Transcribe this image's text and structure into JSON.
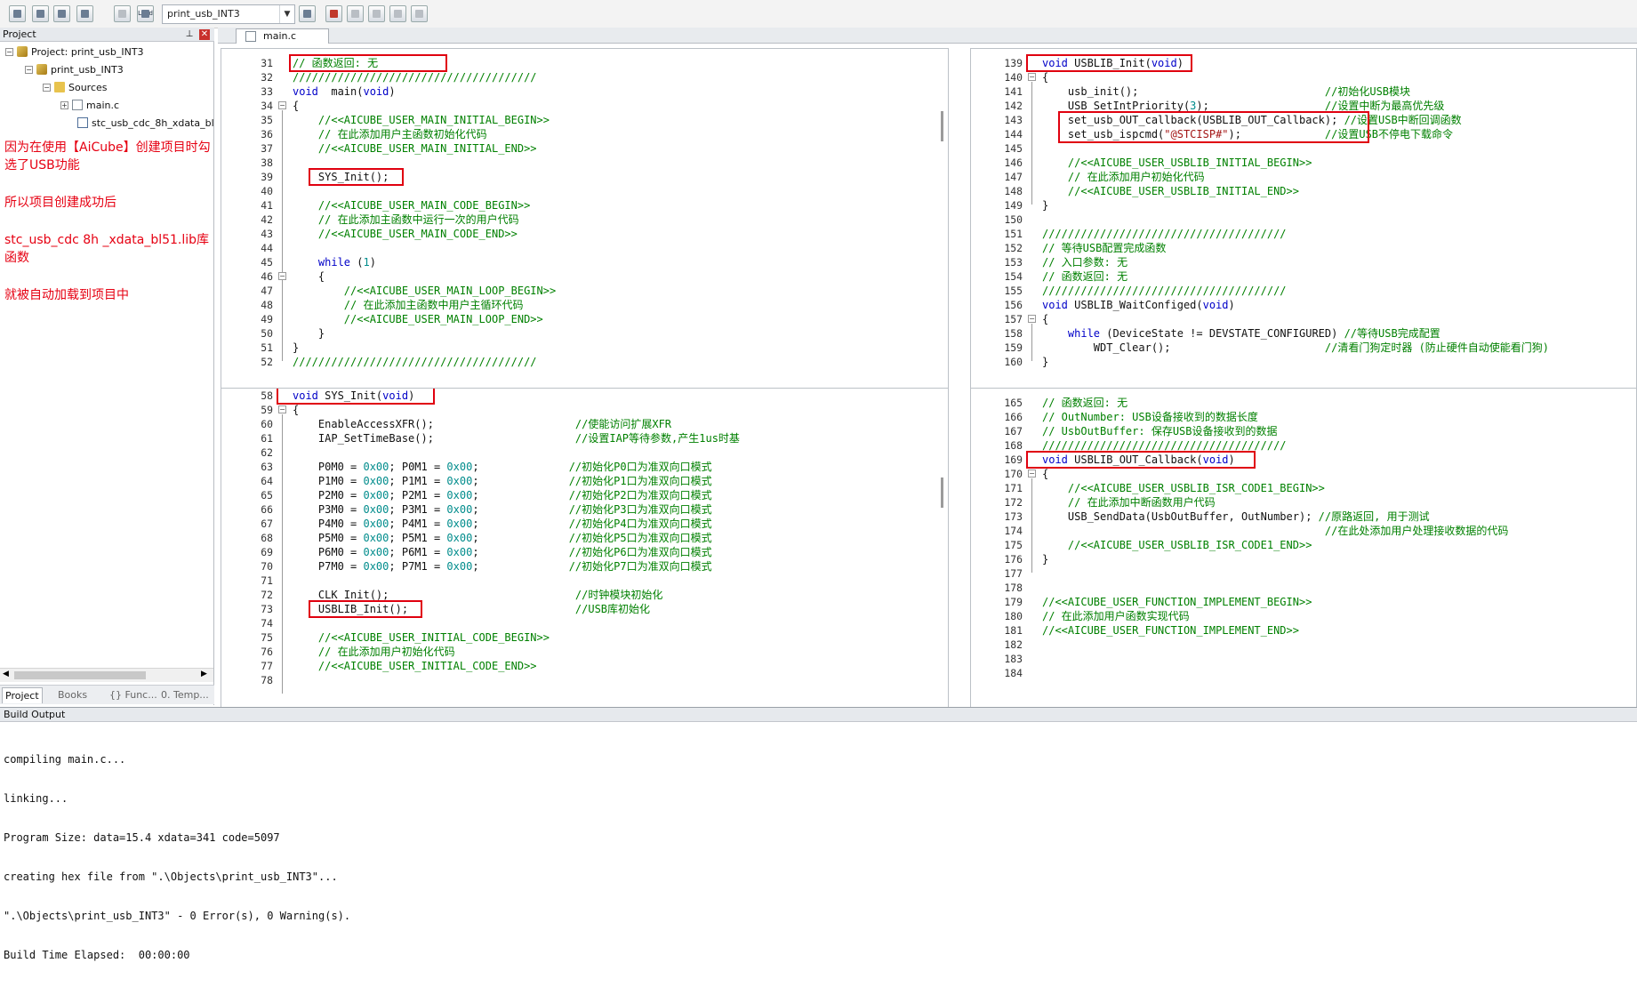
{
  "toolbar": {
    "target": "print_usb_INT3",
    "load_label": "Load"
  },
  "project": {
    "header": "Project",
    "tree": {
      "root": "Project: print_usb_INT3",
      "target": "print_usb_INT3",
      "group": "Sources",
      "files": [
        "main.c",
        "stc_usb_cdc_8h_xdata_bl"
      ]
    },
    "note": [
      "因为在使用【AiCube】创建项目时勾选了USB功能",
      "所以项目创建成功后",
      "stc_usb_cdc 8h _xdata_bl51.lib库函数",
      "就被自动加载到项目中"
    ],
    "tabs": [
      "Project",
      "Books",
      "{} Func...",
      "0. Temp..."
    ]
  },
  "editor": {
    "tab": "main.c",
    "panes": [
      {
        "id": "tl",
        "start": 31,
        "lines": [
          [
            [
              "cm",
              "// 函数返回: 无"
            ]
          ],
          [
            [
              "cm",
              "//////////////////////////////////////"
            ]
          ],
          [
            [
              "kw",
              "void"
            ],
            [
              "",
              "  main("
            ],
            [
              "kw",
              "void"
            ],
            [
              "",
              ")"
            ]
          ],
          [
            [
              "",
              "{"
            ]
          ],
          [
            [
              "cm",
              "    //<<AICUBE_USER_MAIN_INITIAL_BEGIN>>"
            ]
          ],
          [
            [
              "cm",
              "    // 在此添加用户主函数初始化代码"
            ]
          ],
          [
            [
              "cm",
              "    //<<AICUBE_USER_MAIN_INITIAL_END>>"
            ]
          ],
          [
            [
              "",
              ""
            ]
          ],
          [
            [
              "",
              "    SYS_Init();"
            ]
          ],
          [
            [
              "",
              ""
            ]
          ],
          [
            [
              "cm",
              "    //<<AICUBE_USER_MAIN_CODE_BEGIN>>"
            ]
          ],
          [
            [
              "cm",
              "    // 在此添加主函数中运行一次的用户代码"
            ]
          ],
          [
            [
              "cm",
              "    //<<AICUBE_USER_MAIN_CODE_END>>"
            ]
          ],
          [
            [
              "",
              ""
            ]
          ],
          [
            [
              "",
              "    "
            ],
            [
              "kw",
              "while"
            ],
            [
              "",
              " ("
            ],
            [
              "num",
              "1"
            ],
            [
              "",
              ")"
            ]
          ],
          [
            [
              "",
              "    {"
            ]
          ],
          [
            [
              "cm",
              "        //<<AICUBE_USER_MAIN_LOOP_BEGIN>>"
            ]
          ],
          [
            [
              "cm",
              "        // 在此添加主函数中用户主循环代码"
            ]
          ],
          [
            [
              "cm",
              "        //<<AICUBE_USER_MAIN_LOOP_END>>"
            ]
          ],
          [
            [
              "",
              "    }"
            ]
          ],
          [
            [
              "",
              "}"
            ]
          ],
          [
            [
              "cm",
              "//////////////////////////////////////"
            ]
          ]
        ]
      },
      {
        "id": "tr",
        "start": 139,
        "lines": [
          [
            [
              "kw",
              "void"
            ],
            [
              "",
              " USBLIB_Init("
            ],
            [
              "kw",
              "void"
            ],
            [
              "",
              ")"
            ]
          ],
          [
            [
              "",
              "{"
            ]
          ],
          [
            [
              "",
              "    usb_init();                             "
            ],
            [
              "cm",
              "//初始化USB模块"
            ]
          ],
          [
            [
              "",
              "    USB_SetIntPriority("
            ],
            [
              "num",
              "3"
            ],
            [
              "",
              ");                  "
            ],
            [
              "cm",
              "//设置中断为最高优先级"
            ]
          ],
          [
            [
              "",
              "    set_usb_OUT_callback(USBLIB_OUT_Callback); "
            ],
            [
              "cm",
              "//设置USB中断回调函数"
            ]
          ],
          [
            [
              "",
              "    set_usb_ispcmd("
            ],
            [
              "str",
              "\"@STCISP#\""
            ],
            [
              "",
              ");             "
            ],
            [
              "cm",
              "//设置USB不停电下载命令"
            ]
          ],
          [
            [
              "",
              ""
            ]
          ],
          [
            [
              "cm",
              "    //<<AICUBE_USER_USBLIB_INITIAL_BEGIN>>"
            ]
          ],
          [
            [
              "cm",
              "    // 在此添加用户初始化代码"
            ]
          ],
          [
            [
              "cm",
              "    //<<AICUBE_USER_USBLIB_INITIAL_END>>"
            ]
          ],
          [
            [
              "",
              "}"
            ]
          ],
          [
            [
              "",
              ""
            ]
          ],
          [
            [
              "cm",
              "//////////////////////////////////////"
            ]
          ],
          [
            [
              "cm",
              "// 等待USB配置完成函数"
            ]
          ],
          [
            [
              "cm",
              "// 入口参数: 无"
            ]
          ],
          [
            [
              "cm",
              "// 函数返回: 无"
            ]
          ],
          [
            [
              "cm",
              "//////////////////////////////////////"
            ]
          ],
          [
            [
              "kw",
              "void"
            ],
            [
              "",
              " USBLIB_WaitConfiged("
            ],
            [
              "kw",
              "void"
            ],
            [
              "",
              ")"
            ]
          ],
          [
            [
              "",
              "{"
            ]
          ],
          [
            [
              "",
              "    "
            ],
            [
              "kw",
              "while"
            ],
            [
              "",
              " (DeviceState != DEVSTATE_CONFIGURED) "
            ],
            [
              "cm",
              "//等待USB完成配置"
            ]
          ],
          [
            [
              "",
              "        WDT_Clear();                        "
            ],
            [
              "cm",
              "//清看门狗定时器 (防止硬件自动使能看门狗)"
            ]
          ],
          [
            [
              "",
              "}"
            ]
          ]
        ]
      },
      {
        "id": "bl",
        "start": 58,
        "lines": [
          [
            [
              "kw",
              "void"
            ],
            [
              "",
              " SYS_Init("
            ],
            [
              "kw",
              "void"
            ],
            [
              "",
              ")"
            ]
          ],
          [
            [
              "",
              "{"
            ]
          ],
          [
            [
              "",
              "    EnableAccessXFR();                      "
            ],
            [
              "cm",
              "//使能访问扩展XFR"
            ]
          ],
          [
            [
              "",
              "    IAP_SetTimeBase();                      "
            ],
            [
              "cm",
              "//设置IAP等待参数,产生1us时基"
            ]
          ],
          [
            [
              "",
              ""
            ]
          ],
          [
            [
              "",
              "    P0M0 = "
            ],
            [
              "num",
              "0x00"
            ],
            [
              "",
              "; P0M1 = "
            ],
            [
              "num",
              "0x00"
            ],
            [
              "",
              ";              "
            ],
            [
              "cm",
              "//初始化P0口为准双向口模式"
            ]
          ],
          [
            [
              "",
              "    P1M0 = "
            ],
            [
              "num",
              "0x00"
            ],
            [
              "",
              "; P1M1 = "
            ],
            [
              "num",
              "0x00"
            ],
            [
              "",
              ";              "
            ],
            [
              "cm",
              "//初始化P1口为准双向口模式"
            ]
          ],
          [
            [
              "",
              "    P2M0 = "
            ],
            [
              "num",
              "0x00"
            ],
            [
              "",
              "; P2M1 = "
            ],
            [
              "num",
              "0x00"
            ],
            [
              "",
              ";              "
            ],
            [
              "cm",
              "//初始化P2口为准双向口模式"
            ]
          ],
          [
            [
              "",
              "    P3M0 = "
            ],
            [
              "num",
              "0x00"
            ],
            [
              "",
              "; P3M1 = "
            ],
            [
              "num",
              "0x00"
            ],
            [
              "",
              ";              "
            ],
            [
              "cm",
              "//初始化P3口为准双向口模式"
            ]
          ],
          [
            [
              "",
              "    P4M0 = "
            ],
            [
              "num",
              "0x00"
            ],
            [
              "",
              "; P4M1 = "
            ],
            [
              "num",
              "0x00"
            ],
            [
              "",
              ";              "
            ],
            [
              "cm",
              "//初始化P4口为准双向口模式"
            ]
          ],
          [
            [
              "",
              "    P5M0 = "
            ],
            [
              "num",
              "0x00"
            ],
            [
              "",
              "; P5M1 = "
            ],
            [
              "num",
              "0x00"
            ],
            [
              "",
              ";              "
            ],
            [
              "cm",
              "//初始化P5口为准双向口模式"
            ]
          ],
          [
            [
              "",
              "    P6M0 = "
            ],
            [
              "num",
              "0x00"
            ],
            [
              "",
              "; P6M1 = "
            ],
            [
              "num",
              "0x00"
            ],
            [
              "",
              ";              "
            ],
            [
              "cm",
              "//初始化P6口为准双向口模式"
            ]
          ],
          [
            [
              "",
              "    P7M0 = "
            ],
            [
              "num",
              "0x00"
            ],
            [
              "",
              "; P7M1 = "
            ],
            [
              "num",
              "0x00"
            ],
            [
              "",
              ";              "
            ],
            [
              "cm",
              "//初始化P7口为准双向口模式"
            ]
          ],
          [
            [
              "",
              ""
            ]
          ],
          [
            [
              "",
              "    CLK_Init();                             "
            ],
            [
              "cm",
              "//时钟模块初始化"
            ]
          ],
          [
            [
              "",
              "    USBLIB_Init();                          "
            ],
            [
              "cm",
              "//USB库初始化"
            ]
          ],
          [
            [
              "",
              ""
            ]
          ],
          [
            [
              "cm",
              "    //<<AICUBE_USER_INITIAL_CODE_BEGIN>>"
            ]
          ],
          [
            [
              "cm",
              "    // 在此添加用户初始化代码"
            ]
          ],
          [
            [
              "cm",
              "    //<<AICUBE_USER_INITIAL_CODE_END>>"
            ]
          ],
          [
            [
              "",
              ""
            ]
          ]
        ]
      },
      {
        "id": "br",
        "start": 165,
        "lines": [
          [
            [
              "cm",
              "// 函数返回: 无"
            ]
          ],
          [
            [
              "cm",
              "// OutNumber: USB设备接收到的数据长度"
            ]
          ],
          [
            [
              "cm",
              "// UsbOutBuffer: 保存USB设备接收到的数据"
            ]
          ],
          [
            [
              "cm",
              "//////////////////////////////////////"
            ]
          ],
          [
            [
              "kw",
              "void"
            ],
            [
              "",
              " USBLIB_OUT_Callback("
            ],
            [
              "kw",
              "void"
            ],
            [
              "",
              ")"
            ]
          ],
          [
            [
              "",
              "{"
            ]
          ],
          [
            [
              "cm",
              "    //<<AICUBE_USER_USBLIB_ISR_CODE1_BEGIN>>"
            ]
          ],
          [
            [
              "cm",
              "    // 在此添加中断函数用户代码"
            ]
          ],
          [
            [
              "",
              "    USB_SendData(UsbOutBuffer, OutNumber); "
            ],
            [
              "cm",
              "//原路返回, 用于测试"
            ]
          ],
          [
            [
              "",
              "                                            "
            ],
            [
              "cm",
              "//在此处添加用户处理接收数据的代码"
            ]
          ],
          [
            [
              "cm",
              "    //<<AICUBE_USER_USBLIB_ISR_CODE1_END>>"
            ]
          ],
          [
            [
              "",
              "}"
            ]
          ],
          [
            [
              "",
              ""
            ]
          ],
          [
            [
              "",
              ""
            ]
          ],
          [
            [
              "cm",
              "//<<AICUBE_USER_FUNCTION_IMPLEMENT_BEGIN>>"
            ]
          ],
          [
            [
              "cm",
              "// 在此添加用户函数实现代码"
            ]
          ],
          [
            [
              "cm",
              "//<<AICUBE_USER_FUNCTION_IMPLEMENT_END>>"
            ]
          ],
          [
            [
              "",
              ""
            ]
          ],
          [
            [
              "",
              ""
            ]
          ],
          [
            [
              "",
              ""
            ]
          ]
        ]
      }
    ]
  },
  "build": {
    "header": "Build Output",
    "lines": [
      "compiling main.c...",
      "linking...",
      "Program Size: data=15.4 xdata=341 code=5097",
      "creating hex file from \".\\Objects\\print_usb_INT3\"...",
      "\".\\Objects\\print_usb_INT3\" - 0 Error(s), 0 Warning(s).",
      "Build Time Elapsed:  00:00:00"
    ]
  }
}
